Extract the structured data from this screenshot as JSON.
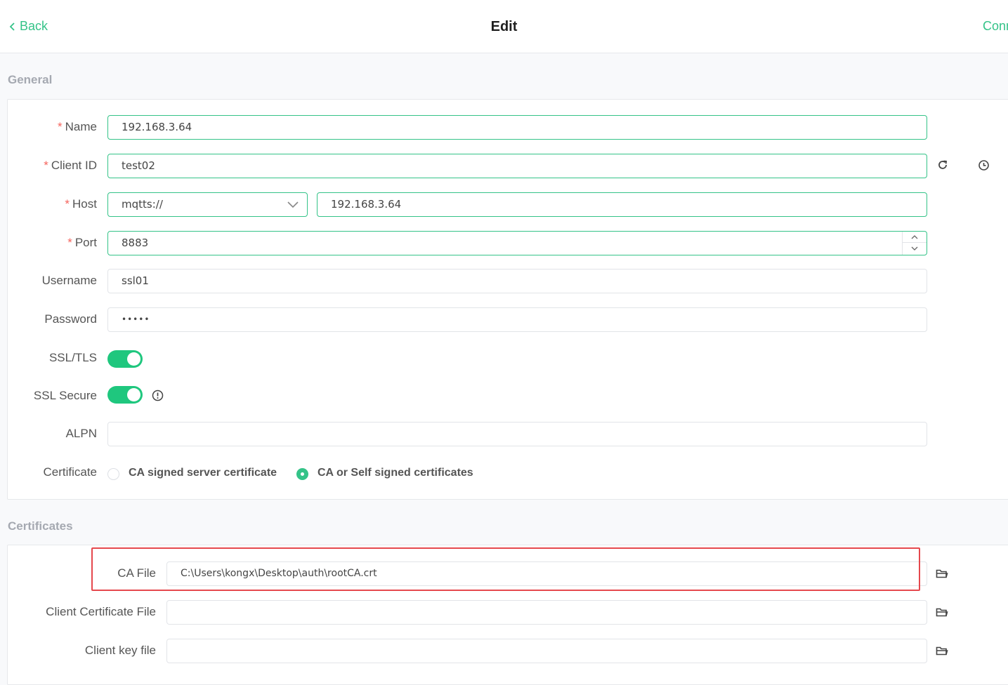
{
  "header": {
    "back_label": "Back",
    "title": "Edit",
    "connect_label": "Conn"
  },
  "general": {
    "section_title": "General",
    "name": {
      "label": "Name",
      "value": "192.168.3.64"
    },
    "client_id": {
      "label": "Client ID",
      "value": "test02"
    },
    "host": {
      "label": "Host",
      "protocol": "mqtts://",
      "value": "192.168.3.64"
    },
    "port": {
      "label": "Port",
      "value": "8883"
    },
    "username": {
      "label": "Username",
      "value": "ssl01"
    },
    "password": {
      "label": "Password",
      "value": "•••••"
    },
    "ssl_tls": {
      "label": "SSL/TLS",
      "enabled": true
    },
    "ssl_secure": {
      "label": "SSL Secure",
      "enabled": true
    },
    "alpn": {
      "label": "ALPN",
      "value": ""
    },
    "certificate": {
      "label": "Certificate",
      "options": [
        "CA signed server certificate",
        "CA or Self signed certificates"
      ],
      "selected": "CA or Self signed certificates"
    }
  },
  "certificates": {
    "section_title": "Certificates",
    "ca_file": {
      "label": "CA File",
      "value": "C:\\Users\\kongx\\Desktop\\auth\\rootCA.crt"
    },
    "client_cert": {
      "label": "Client Certificate File",
      "value": ""
    },
    "client_key": {
      "label": "Client key file",
      "value": ""
    }
  },
  "colors": {
    "accent": "#34c388",
    "toggle_on": "#1fc77e",
    "highlight": "#e5484d",
    "required": "#f5655e"
  },
  "icons": {
    "back": "chevron-left-icon",
    "refresh": "refresh-icon",
    "clock": "clock-icon",
    "dropdown": "chevron-down-icon",
    "info": "info-icon",
    "folder": "folder-icon"
  }
}
